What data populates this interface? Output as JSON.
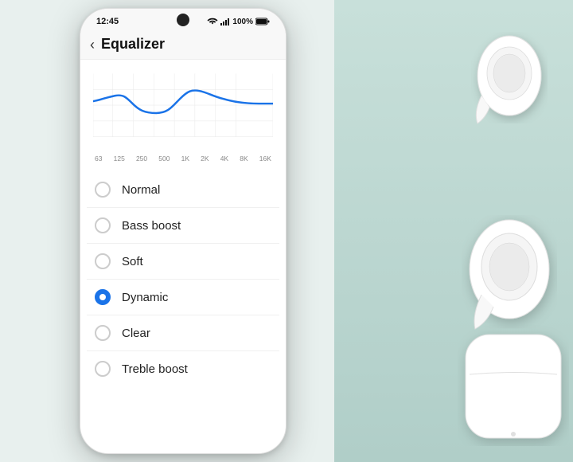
{
  "background": {
    "color": "#b8d8d0"
  },
  "statusBar": {
    "time": "12:45",
    "battery": "100%",
    "signal": "wifi+signal"
  },
  "header": {
    "back_label": "‹",
    "title": "Equalizer"
  },
  "chart": {
    "labels": [
      "63",
      "125",
      "250",
      "500",
      "1K",
      "2K",
      "4K",
      "8K",
      "16K"
    ]
  },
  "equalizerOptions": [
    {
      "id": "normal",
      "label": "Normal",
      "selected": false
    },
    {
      "id": "bass-boost",
      "label": "Bass boost",
      "selected": false
    },
    {
      "id": "soft",
      "label": "Soft",
      "selected": false
    },
    {
      "id": "dynamic",
      "label": "Dynamic",
      "selected": true
    },
    {
      "id": "clear",
      "label": "Clear",
      "selected": false
    },
    {
      "id": "treble-boost",
      "label": "Treble boost",
      "selected": false
    }
  ]
}
